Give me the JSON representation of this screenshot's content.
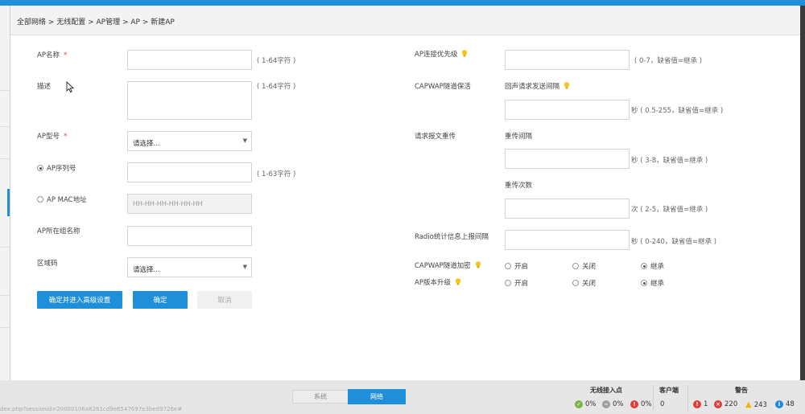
{
  "breadcrumb": "全部网络 > 无线配置 > AP管理 > AP > 新建AP",
  "form": {
    "ap_name_label": "AP名称",
    "required_mark": "*",
    "ap_name_hint": "( 1-64字符 )",
    "desc_label": "描述",
    "desc_hint": "( 1-64字符 )",
    "model_label": "AP型号",
    "model_select": "请选择...",
    "serial_label": "AP序列号",
    "serial_hint": "( 1-63字符 )",
    "mac_label": "AP MAC地址",
    "mac_placeholder": "HH-HH-HH-HH-HH-HH",
    "group_label": "AP所在组名称",
    "region_label": "区域码",
    "region_select": "请选择..."
  },
  "right_form": {
    "priority_label": "AP连接优先级",
    "priority_hint": "( 0-7，缺省值=继承 )",
    "keepalive_label": "CAPWAP隧道保活",
    "echo_label": "回声请求发送间隔",
    "echo_hint": "秒 ( 0.5-255，缺省值=继承 )",
    "retrans_label": "请求报文重传",
    "interval_label": "重传间隔",
    "interval_hint": "秒 ( 3-8，缺省值=继承 )",
    "count_label": "重传次数",
    "count_hint": "次 ( 2-5，缺省值=继承 )",
    "radio_label": "Radio统计信息上报间隔",
    "radio_hint": "秒 ( 0-240，缺省值=继承 )",
    "encrypt_label": "CAPWAP隧道加密",
    "upgrade_label": "AP版本升级",
    "opt_on": "开启",
    "opt_off": "关闭",
    "opt_inherit": "继承"
  },
  "buttons": {
    "confirm_advanced": "确定并进入高级设置",
    "confirm": "确定",
    "cancel": "取消"
  },
  "bottom": {
    "url": "dex.php?sessionid=20000106a8261cd9e6547697e3bed9726e#",
    "tab_system": "系统",
    "tab_network": "网络",
    "wireless_title": "无线接入点",
    "wireless_green": "0%",
    "wireless_gray": "0%",
    "wireless_red": "0%",
    "client_title": "客户端",
    "client_count": "0",
    "alarm_title": "警告",
    "alarm_critical": "1",
    "alarm_major": "220",
    "alarm_minor": "243",
    "alarm_info": "48"
  },
  "colors": {
    "accent": "#1f8fd9",
    "required": "#e53935",
    "ok": "#7cb342",
    "neutral": "#9e9e9e",
    "error": "#e53935",
    "warning": "#f5b400",
    "info": "#1e88e5"
  }
}
